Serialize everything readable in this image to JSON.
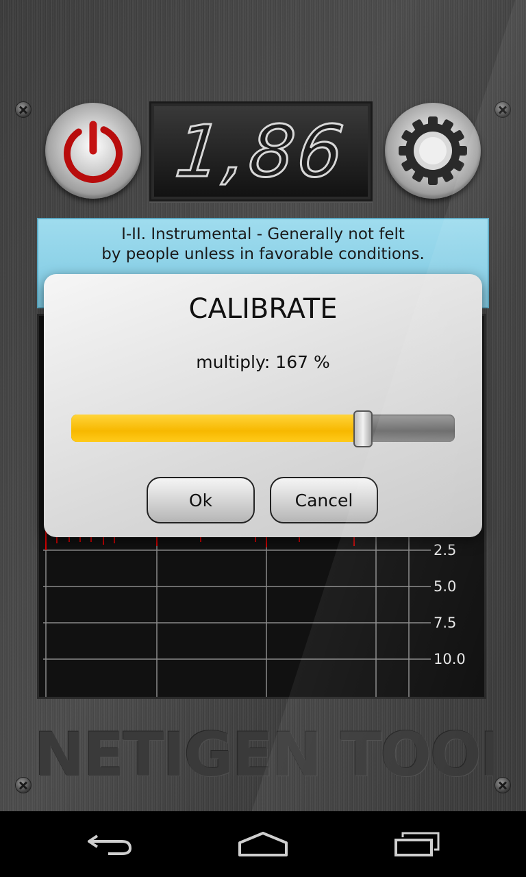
{
  "display": {
    "value": "1,86"
  },
  "info": {
    "line1": "I-II. Instrumental - Generally not felt",
    "line2": "by people unless in favorable conditions."
  },
  "graph": {
    "y_ticks": [
      "2.5",
      "5.0",
      "7.5",
      "10.0"
    ]
  },
  "watermark": "NETIGEN TOOLS",
  "dialog": {
    "title": "CALIBRATE",
    "text": "multiply: 167 %",
    "slider_fraction": 0.76,
    "ok_label": "Ok",
    "cancel_label": "Cancel"
  },
  "colors": {
    "slider_fill": "#ffc400",
    "banner": "#8fd3ea",
    "power_red": "#c01010"
  },
  "icons": {
    "power": "power-icon",
    "settings": "gear-icon",
    "back": "back-icon",
    "home": "home-icon",
    "recents": "recents-icon"
  }
}
